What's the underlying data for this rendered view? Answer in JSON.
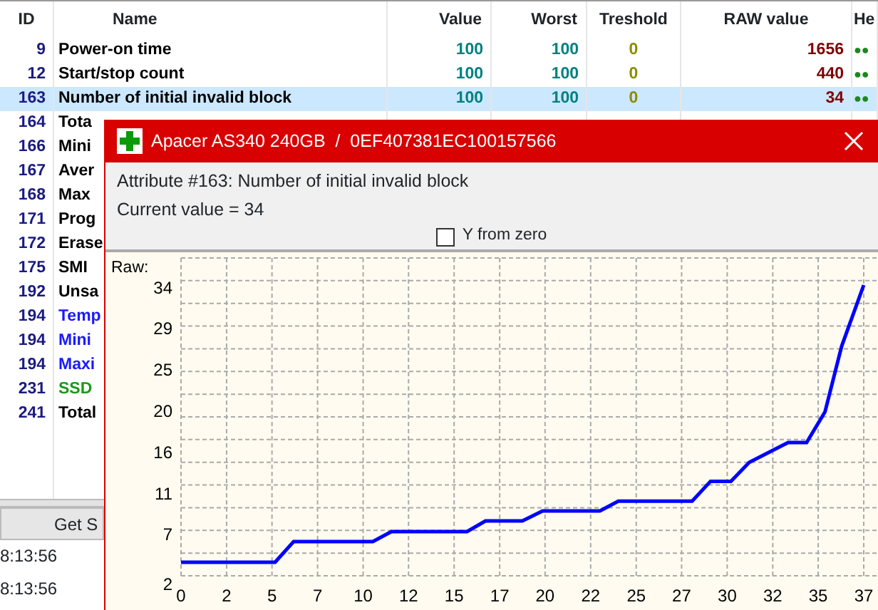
{
  "table": {
    "columns": [
      "ID",
      "Name",
      "Value",
      "Worst",
      "Treshold",
      "RAW value",
      "He"
    ],
    "rows": [
      {
        "id": "9",
        "name": "Power-on time",
        "value": "100",
        "worst": "100",
        "threshold": "0",
        "raw": "1656",
        "health": "●●",
        "selected": false,
        "color": "#000000"
      },
      {
        "id": "12",
        "name": "Start/stop count",
        "value": "100",
        "worst": "100",
        "threshold": "0",
        "raw": "440",
        "health": "●●",
        "selected": false,
        "color": "#000000"
      },
      {
        "id": "163",
        "name": "Number of initial invalid block",
        "value": "100",
        "worst": "100",
        "threshold": "0",
        "raw": "34",
        "health": "●●",
        "selected": true,
        "color": "#000000"
      },
      {
        "id": "164",
        "name": "Tota",
        "selected": false,
        "color": "#000000"
      },
      {
        "id": "166",
        "name": "Mini",
        "selected": false,
        "color": "#000000"
      },
      {
        "id": "167",
        "name": "Aver",
        "selected": false,
        "color": "#000000"
      },
      {
        "id": "168",
        "name": "Max",
        "selected": false,
        "color": "#000000"
      },
      {
        "id": "171",
        "name": "Prog",
        "selected": false,
        "color": "#000000"
      },
      {
        "id": "172",
        "name": "Erase",
        "selected": false,
        "color": "#000000"
      },
      {
        "id": "175",
        "name": "SMI",
        "selected": false,
        "color": "#000000"
      },
      {
        "id": "192",
        "name": "Unsa",
        "selected": false,
        "color": "#000000"
      },
      {
        "id": "194",
        "name": "Temp",
        "selected": false,
        "color": "#1a1aff"
      },
      {
        "id": "194",
        "name": "Mini",
        "selected": false,
        "color": "#1a1aff"
      },
      {
        "id": "194",
        "name": "Maxi",
        "selected": false,
        "color": "#1a1aff"
      },
      {
        "id": "231",
        "name": "SSD",
        "selected": false,
        "color": "#1a9a1a"
      },
      {
        "id": "241",
        "name": "Total",
        "selected": false,
        "color": "#000000"
      }
    ]
  },
  "button": "Get S",
  "log": [
    {
      "time": "8:13:56"
    },
    {
      "time": "8:13:56"
    }
  ],
  "dialog": {
    "title": "Apacer AS340 240GB  /  0EF407381EC100157566",
    "attribute": "Attribute #163: Number of initial invalid block",
    "current": "Current value = 34",
    "checkbox": {
      "label": "Y from zero",
      "checked": false
    },
    "chart_data": {
      "type": "line",
      "ylabel": "Raw:",
      "grid": true,
      "x": [
        0,
        5.1,
        6.1,
        10.4,
        11.4,
        15.5,
        16.5,
        18.5,
        19.6,
        22.7,
        23.7,
        27.7,
        28.7,
        29.8,
        30.8,
        32.9,
        33.9,
        34.9,
        35.8,
        37
      ],
      "series": [
        {
          "color": "#0000ff",
          "values": [
            3.5,
            3.5,
            5.8,
            5.8,
            6.9,
            6.9,
            8.1,
            8.1,
            9.2,
            9.2,
            10.3,
            10.3,
            12.5,
            12.5,
            14.6,
            16.8,
            16.8,
            20.2,
            27.5,
            34.3
          ]
        }
      ],
      "xlim": [
        0,
        37
      ],
      "ylim": [
        2,
        37.3
      ],
      "xticks": [
        0,
        {
          "value": 2.47,
          "label": "2"
        },
        {
          "value": 4.93,
          "label": "5"
        },
        {
          "value": 7.4,
          "label": "7"
        },
        {
          "value": 9.87,
          "label": "10"
        },
        {
          "value": 12.33,
          "label": "12"
        },
        {
          "value": 14.8,
          "label": "15"
        },
        {
          "value": 17.27,
          "label": "17"
        },
        {
          "value": 19.73,
          "label": "20"
        },
        {
          "value": 22.2,
          "label": "22"
        },
        {
          "value": 24.67,
          "label": "25"
        },
        {
          "value": 27.13,
          "label": "27"
        },
        {
          "value": 29.6,
          "label": "30"
        },
        {
          "value": 32.07,
          "label": "32"
        },
        {
          "value": 34.53,
          "label": "35"
        },
        37
      ],
      "yticks": [
        2,
        {
          "value": 6.57,
          "label": "7"
        },
        {
          "value": 11.14,
          "label": "11"
        },
        {
          "value": 15.71,
          "label": "16"
        },
        {
          "value": 20.29,
          "label": "20"
        },
        {
          "value": 24.86,
          "label": "25"
        },
        {
          "value": 29.43,
          "label": "29"
        },
        34
      ]
    }
  }
}
